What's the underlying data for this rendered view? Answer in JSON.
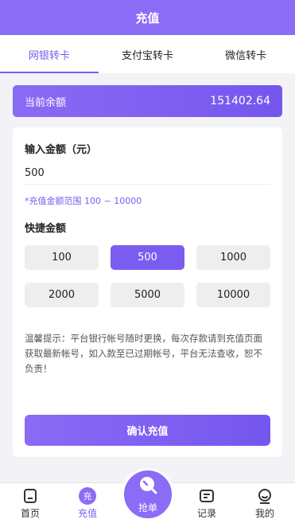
{
  "header": {
    "title": "充值"
  },
  "tabs": [
    {
      "label": "网银转卡",
      "active": true
    },
    {
      "label": "支付宝转卡",
      "active": false
    },
    {
      "label": "微信转卡",
      "active": false
    }
  ],
  "balance": {
    "label": "当前余额",
    "value": "151402.64"
  },
  "form": {
    "input_title": "输入金额（元）",
    "amount_value": "500",
    "range_hint": "*充值金额范围 100 ~ 10000",
    "quick_title": "快捷金额",
    "quick_amounts": [
      "100",
      "500",
      "1000",
      "2000",
      "5000",
      "10000"
    ],
    "selected_amount": "500",
    "tip": "温馨提示：平台银行帐号随时更换，每次存款请到充值页面获取最新帐号，如入款至已过期帐号，平台无法查收，恕不负责！",
    "confirm_label": "确认充值"
  },
  "tabbar": {
    "items": [
      {
        "label": "首页",
        "icon": "home-icon",
        "active": false
      },
      {
        "label": "充值",
        "icon": "recharge-icon",
        "icon_text": "充",
        "active": true
      },
      {
        "label": "抢单",
        "icon": "grab-order-icon",
        "active": false
      },
      {
        "label": "记录",
        "icon": "records-icon",
        "active": false
      },
      {
        "label": "我的",
        "icon": "profile-icon",
        "active": false
      }
    ]
  },
  "colors": {
    "accent": "#7b5cf0",
    "header_bg": "#8b6cf6",
    "page_bg": "#f3f3f7"
  }
}
